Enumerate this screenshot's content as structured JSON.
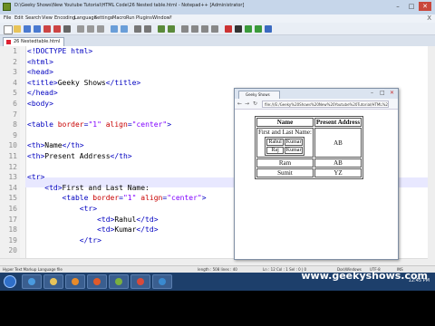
{
  "app": {
    "title": "D:\\Geeky Shows\\New Youtube Tutorial\\HTML Code\\26 Nested table.html - Notepad++ [Administrator]",
    "window_controls": [
      "–",
      "□",
      "✕"
    ],
    "menu": [
      "File",
      "Edit",
      "Search",
      "View",
      "Encoding",
      "Language",
      "Settings",
      "Macro",
      "Run",
      "Plugins",
      "Window",
      "?"
    ],
    "menu_close": "X",
    "tab_label": "26 Nestedtable.html"
  },
  "editor": {
    "line_numbers": [
      "1",
      "2",
      "3",
      "4",
      "5",
      "6",
      "7",
      "8",
      "9",
      "10",
      "11",
      "12",
      "13",
      "14",
      "15",
      "16",
      "17",
      "18",
      "19",
      "20"
    ],
    "lines": [
      [
        {
          "t": "tag",
          "s": "<!DOCTYPE html>"
        }
      ],
      [
        {
          "t": "tag",
          "s": "<html>"
        }
      ],
      [
        {
          "t": "tag",
          "s": "<head>"
        }
      ],
      [
        {
          "t": "tag",
          "s": "<title>"
        },
        {
          "t": "txt",
          "s": "Geeky Shows"
        },
        {
          "t": "tag",
          "s": "</title>"
        }
      ],
      [
        {
          "t": "tag",
          "s": "</head>"
        }
      ],
      [
        {
          "t": "tag",
          "s": "<body>"
        }
      ],
      [],
      [
        {
          "t": "tag",
          "s": "<table "
        },
        {
          "t": "attr",
          "s": "border"
        },
        {
          "t": "tag",
          "s": "="
        },
        {
          "t": "val",
          "s": "\"1\""
        },
        {
          "t": "tag",
          "s": " "
        },
        {
          "t": "attr",
          "s": "align"
        },
        {
          "t": "tag",
          "s": "="
        },
        {
          "t": "val",
          "s": "\"center\""
        },
        {
          "t": "tag",
          "s": ">"
        }
      ],
      [],
      [
        {
          "t": "tag",
          "s": "<th>"
        },
        {
          "t": "txt",
          "s": "Name"
        },
        {
          "t": "tag",
          "s": "</th>"
        }
      ],
      [
        {
          "t": "tag",
          "s": "<th>"
        },
        {
          "t": "txt",
          "s": "Present Address"
        },
        {
          "t": "tag",
          "s": "</th>"
        }
      ],
      [],
      [
        {
          "t": "tag",
          "s": "<tr>"
        }
      ],
      [
        {
          "t": "txt",
          "s": "    "
        },
        {
          "t": "tag",
          "s": "<td>"
        },
        {
          "t": "txt",
          "s": "First and Last Name:"
        }
      ],
      [
        {
          "t": "txt",
          "s": "        "
        },
        {
          "t": "tag",
          "s": "<table "
        },
        {
          "t": "attr",
          "s": "border"
        },
        {
          "t": "tag",
          "s": "="
        },
        {
          "t": "val",
          "s": "\"1\""
        },
        {
          "t": "tag",
          "s": " "
        },
        {
          "t": "attr",
          "s": "align"
        },
        {
          "t": "tag",
          "s": "="
        },
        {
          "t": "val",
          "s": "\"center\""
        },
        {
          "t": "tag",
          "s": ">"
        }
      ],
      [
        {
          "t": "txt",
          "s": "            "
        },
        {
          "t": "tag",
          "s": "<tr>"
        }
      ],
      [
        {
          "t": "txt",
          "s": "                "
        },
        {
          "t": "tag",
          "s": "<td>"
        },
        {
          "t": "txt",
          "s": "Rahul"
        },
        {
          "t": "tag",
          "s": "</td>"
        }
      ],
      [
        {
          "t": "txt",
          "s": "                "
        },
        {
          "t": "tag",
          "s": "<td>"
        },
        {
          "t": "txt",
          "s": "Kumar"
        },
        {
          "t": "tag",
          "s": "</td>"
        }
      ],
      [
        {
          "t": "txt",
          "s": "            "
        },
        {
          "t": "tag",
          "s": "</tr>"
        }
      ],
      []
    ]
  },
  "status": {
    "lang": "Hyper Text Markup Language file",
    "length": "length : 508   lines : 40",
    "pos": "Ln : 12   Col : 1   Sel : 0 | 0",
    "eol": "Dos\\Windows",
    "enc": "UTF-8",
    "mode": "INS"
  },
  "browser": {
    "tab_title": "Geeky Shows",
    "url": "file:///E:/Geeky%20Shows%20New%20Youtube%20Tutorial/HTML%20Code/26%20Nestedtable.html",
    "headers": [
      "Name",
      "Present Address"
    ],
    "row1_label": "First and Last Name:",
    "inner_rows": [
      [
        "Rahul",
        "Kumar"
      ],
      [
        "Raj",
        "Kumar"
      ]
    ],
    "row1_address": "AB",
    "rows": [
      [
        "Ram",
        "AB"
      ],
      [
        "Sumit",
        "YZ"
      ]
    ]
  },
  "taskbar": {
    "time": "12:45 PM"
  },
  "watermark": "www.geekyshows.com",
  "colors": {
    "titlebar": "#c6d6ea",
    "tag": "#0000c0",
    "attr": "#c80000",
    "value": "#8000ff",
    "taskbar": "#1d3f6b"
  }
}
